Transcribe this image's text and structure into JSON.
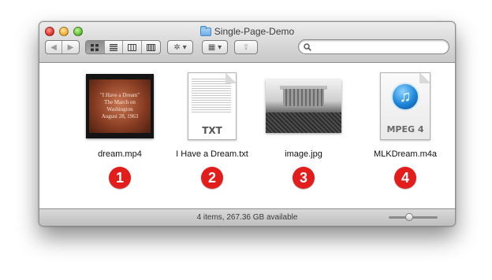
{
  "window": {
    "title": "Single-Page-Demo"
  },
  "toolbar": {
    "back_glyph": "◀",
    "forward_glyph": "▶",
    "view_icons": [
      "icon-view-icon",
      "list-view-icon",
      "column-view-icon",
      "coverflow-view-icon"
    ],
    "active_view": "icon-view",
    "gear_glyph": "✲ ▾",
    "arrange_glyph": "▦ ▾",
    "share_glyph": "⇪",
    "search_placeholder": ""
  },
  "files": [
    {
      "name": "dream.mp4",
      "badge": "1",
      "thumb_lines": [
        "\"I Have a Dream\"",
        "The March on",
        "Washington",
        "August 28, 1963"
      ]
    },
    {
      "name": "I Have a Dream.txt",
      "badge": "2",
      "icon_label": "TXT"
    },
    {
      "name": "image.jpg",
      "badge": "3"
    },
    {
      "name": "MLKDream.m4a",
      "badge": "4",
      "icon_label": "MPEG 4",
      "icon_glyph": "♫"
    }
  ],
  "status": {
    "text": "4 items, 267.36 GB available",
    "icon_size_level": 0.4
  },
  "colors": {
    "badge": "#e31c1c",
    "folder": "#6eaee4"
  }
}
